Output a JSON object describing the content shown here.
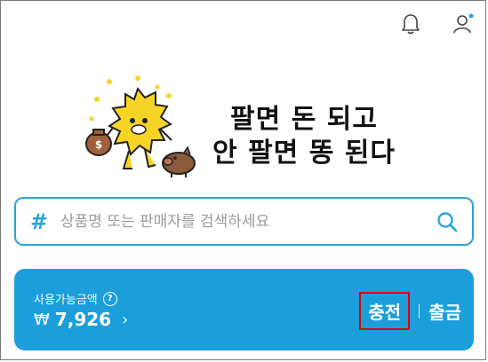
{
  "header": {
    "icons": [
      "bell-icon",
      "user-icon"
    ]
  },
  "banner": {
    "line1": "팔면 돈 되고",
    "line2": "안 팔면 똥 된다",
    "character_bag_text": "$"
  },
  "search": {
    "prefix": "#",
    "placeholder": "상품명 또는 판매자를 검색하세요"
  },
  "wallet": {
    "label": "사용가능금액",
    "help": "?",
    "currency_symbol": "₩",
    "amount": "7,926",
    "chevron": "›",
    "charge_label": "충전",
    "withdraw_label": "출금"
  },
  "colors": {
    "accent": "#1c9edb",
    "highlight": "#e00000",
    "character": "#f6d526"
  }
}
